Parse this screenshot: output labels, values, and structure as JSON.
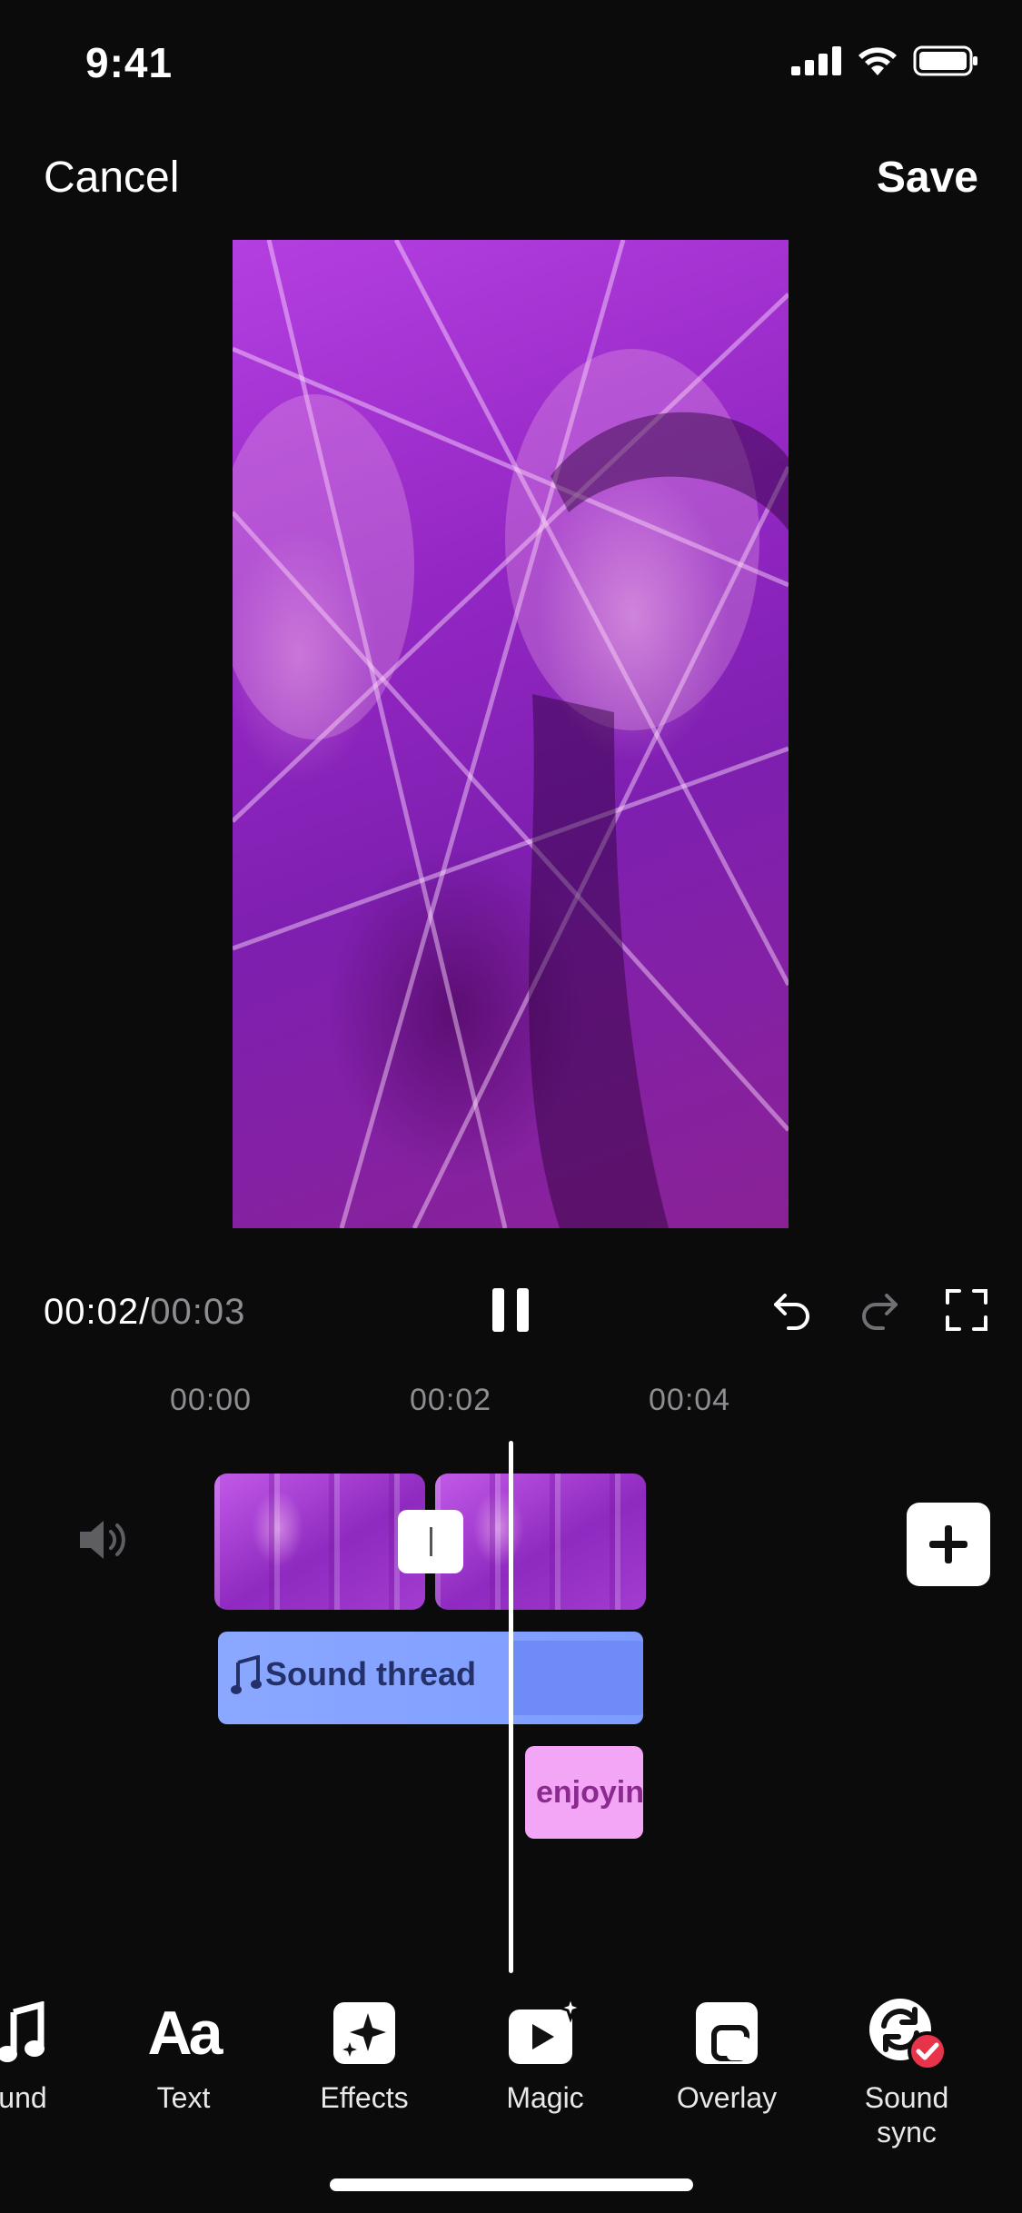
{
  "status": {
    "time": "9:41"
  },
  "nav": {
    "cancel": "Cancel",
    "save": "Save"
  },
  "playback": {
    "current": "00:02",
    "separator": "/",
    "total": "00:03"
  },
  "ruler": {
    "ticks": [
      "00:00",
      "00:02",
      "00:04"
    ]
  },
  "timeline": {
    "sound_track_label": "Sound thread",
    "text_track_label": "enjoyin"
  },
  "toolbar": {
    "items": [
      {
        "label": "und",
        "icon": "music-note-icon"
      },
      {
        "label": "Text",
        "icon": "text-aa-icon"
      },
      {
        "label": "Effects",
        "icon": "sparkle-icon"
      },
      {
        "label": "Magic",
        "icon": "magic-video-icon"
      },
      {
        "label": "Overlay",
        "icon": "overlay-icon"
      },
      {
        "label": "Sound\nsync",
        "icon": "sound-sync-icon"
      }
    ]
  },
  "colors": {
    "background": "#0b0b0c",
    "sound_track": "#8aa8ff",
    "text_track": "#f4a6f6",
    "sync_badge": "#e8334a"
  }
}
